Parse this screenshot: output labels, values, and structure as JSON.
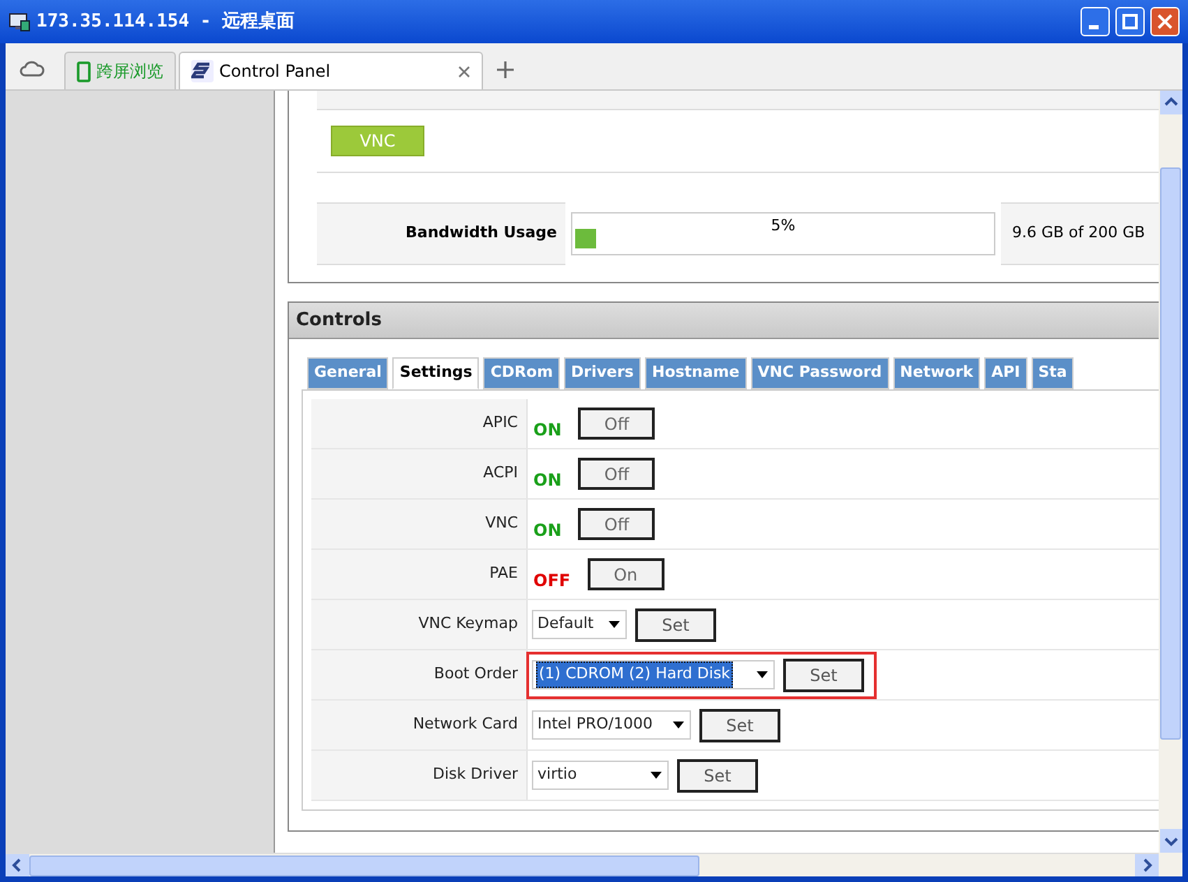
{
  "window": {
    "title": "173.35.114.154 - 远程桌面"
  },
  "browser_tabs": [
    {
      "label": "跨屏浏览",
      "selected": false
    },
    {
      "label": "Control Panel",
      "selected": true
    }
  ],
  "vnc_button": "VNC",
  "bandwidth": {
    "label": "Bandwidth Usage",
    "percent": "5%",
    "level": 0.05,
    "reading": "9.6 GB of 200 GB"
  },
  "controls": {
    "title": "Controls",
    "tabs": [
      {
        "label": "General",
        "selected": false
      },
      {
        "label": "Settings",
        "selected": true
      },
      {
        "label": "CDRom",
        "selected": false
      },
      {
        "label": "Drivers",
        "selected": false
      },
      {
        "label": "Hostname",
        "selected": false
      },
      {
        "label": "VNC Password",
        "selected": false
      },
      {
        "label": "Network",
        "selected": false
      },
      {
        "label": "API",
        "selected": false
      },
      {
        "label": "Sta",
        "selected": false
      }
    ],
    "settings": [
      {
        "kind": "toggle",
        "label": "APIC",
        "status": "ON",
        "on": true,
        "button": "Off"
      },
      {
        "kind": "toggle",
        "label": "ACPI",
        "status": "ON",
        "on": true,
        "button": "Off"
      },
      {
        "kind": "toggle",
        "label": "VNC",
        "status": "ON",
        "on": true,
        "button": "Off"
      },
      {
        "kind": "toggle",
        "label": "PAE",
        "status": "OFF",
        "on": false,
        "button": "On"
      },
      {
        "kind": "select",
        "label": "VNC Keymap",
        "value": "Default",
        "button": "Set",
        "highlighted": false
      },
      {
        "kind": "select",
        "label": "Boot Order",
        "value": "(1) CDROM (2) Hard Disk",
        "button": "Set",
        "highlighted": true
      },
      {
        "kind": "select",
        "label": "Network Card",
        "value": "Intel PRO/1000",
        "button": "Set",
        "highlighted": false
      },
      {
        "kind": "select",
        "label": "Disk Driver",
        "value": "virtio",
        "button": "Set",
        "highlighted": false
      }
    ]
  }
}
